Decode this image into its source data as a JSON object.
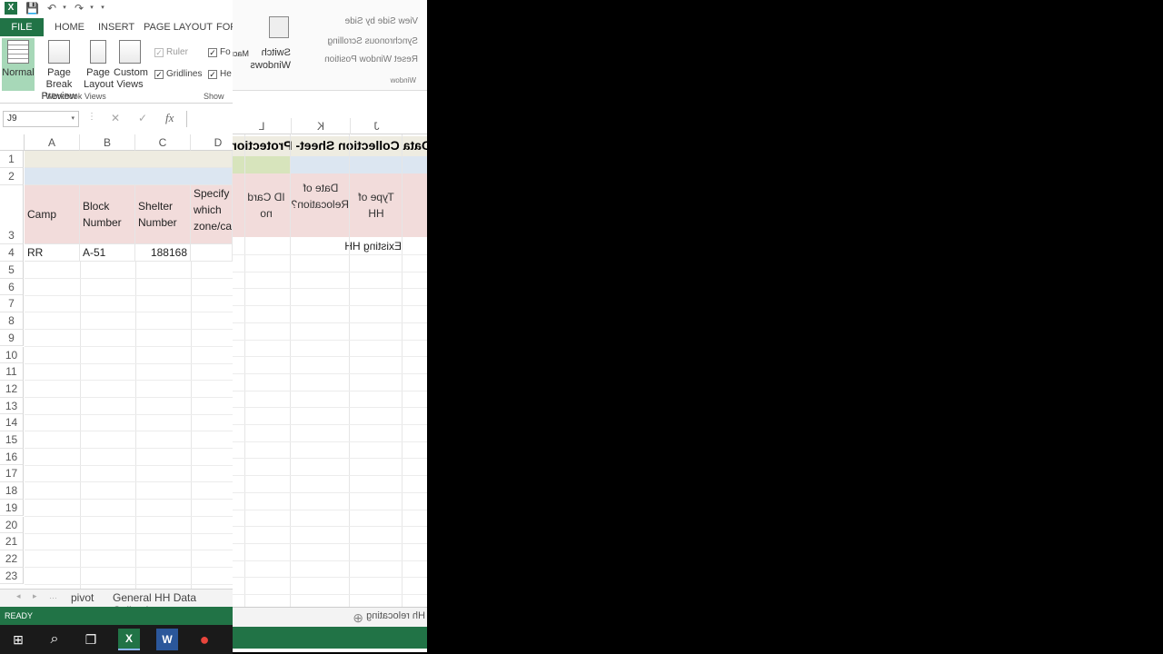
{
  "qat": {
    "excel_logo": "X",
    "save_icon": "💾",
    "undo_icon": "↶",
    "redo_icon": "↷",
    "more_icon": "▾"
  },
  "tabs": {
    "file": "FILE",
    "home": "HOME",
    "insert": "INSERT",
    "page_layout": "PAGE LAYOUT",
    "formulas": "FOR"
  },
  "ribbon": {
    "normal": "Normal",
    "page_break_1": "Page Break",
    "page_break_2": "Preview",
    "page_layout_1": "Page",
    "page_layout_2": "Layout",
    "custom_views_1": "Custom",
    "custom_views_2": "Views",
    "workbook_views_label": "Workbook Views",
    "ruler": "Ruler",
    "gridlines": "Gridlines",
    "fo": "Fo",
    "he": "He",
    "show_label": "Show",
    "check": "✓"
  },
  "formula_bar": {
    "namebox": "J9",
    "namebox_arrow": "▾",
    "colon": "⋮",
    "cancel": "✕",
    "enter": "✓",
    "fx": "fx"
  },
  "grid": {
    "columns": [
      "A",
      "B",
      "C",
      "D"
    ],
    "rows": [
      "1",
      "2",
      "3",
      "4",
      "5",
      "6",
      "7",
      "8",
      "9",
      "10",
      "11",
      "12",
      "13",
      "14",
      "15",
      "16",
      "17",
      "18",
      "19",
      "20",
      "21",
      "22",
      "23"
    ],
    "headers": {
      "camp": "Camp",
      "block": "Block Number",
      "shelter": "Shelter Number",
      "specify": "Specify which zone/camp"
    },
    "row4": {
      "camp": "RR",
      "block": "A-51",
      "shelter": "188168"
    }
  },
  "sheet_tabs": {
    "nav_prev": "◂",
    "nav_next": "▸",
    "more": "…",
    "pivot": "pivot",
    "general": "General HH Data Collectio"
  },
  "status": {
    "ready": "READY"
  },
  "flip": {
    "switch_1": "Switch",
    "switch_2": "Windows",
    "macros": "Macros",
    "view_side": "View Side by Side",
    "sync_scroll": "Synchronous Scrolling",
    "reset_window": "Reset Window Position",
    "window_label": "Window",
    "cols": [
      "L",
      "K",
      "J"
    ],
    "title": "Data Collection Sheet- Protection (Camp",
    "id_card": "ID Card no",
    "date_relocation": "Date of Relocation?",
    "type_hh": "Type of HH",
    "existing_hh": "Existing HH",
    "tab_relocating": "Hh relocating",
    "plus": "⊕"
  },
  "taskbar": {
    "windows_icon": "⊞",
    "search_icon": "⌕",
    "taskview_icon": "❐",
    "excel_icon": "X",
    "word_icon": "W",
    "chrome_icon": "●"
  },
  "colors": {
    "excel_green": "#217346",
    "header_pink": "#f2dcdb",
    "row1": "#eeece1",
    "row2": "#dce6f1",
    "flip_green": "#d7e4bc"
  }
}
